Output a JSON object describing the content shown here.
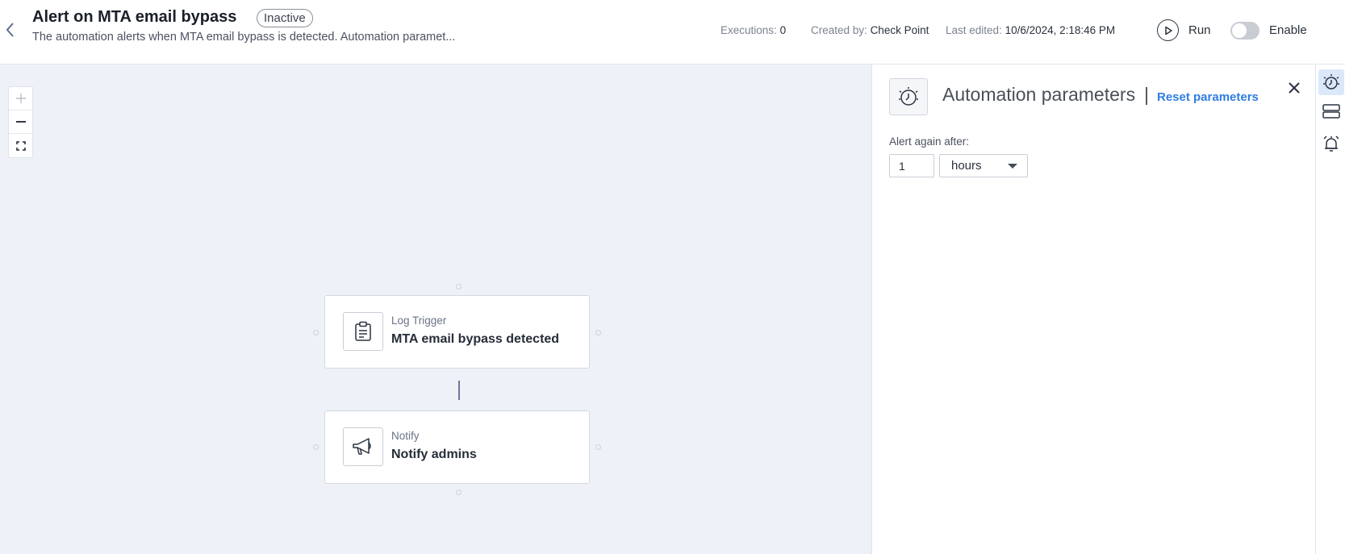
{
  "header": {
    "title": "Alert on MTA email bypass",
    "status": "Inactive",
    "description": "The automation alerts when MTA email bypass is detected. Automation paramet...",
    "executions_label": "Executions:",
    "executions_value": "0",
    "created_by_label": "Created by:",
    "created_by_value": "Check Point",
    "last_edited_label": "Last edited:",
    "last_edited_value": "10/6/2024, 2:18:46 PM",
    "run_label": "Run",
    "enable_label": "Enable",
    "enabled": false
  },
  "canvas": {
    "zoom_controls": [
      "zoom-in",
      "zoom-out",
      "fit-to-screen"
    ],
    "nodes": [
      {
        "type": "Log Trigger",
        "name": "MTA email bypass detected",
        "icon": "clipboard-icon"
      },
      {
        "type": "Notify",
        "name": "Notify admins",
        "icon": "megaphone-icon"
      }
    ]
  },
  "panel": {
    "title": "Automation parameters",
    "separator": "|",
    "reset_label": "Reset parameters",
    "field_label": "Alert again after:",
    "field_value": "1",
    "unit_value": "hours"
  },
  "rail": {
    "icons": [
      "alarm-gear-icon",
      "layers-icon",
      "alarm-bell-icon"
    ],
    "active": "alarm-gear-icon"
  },
  "colors": {
    "accent": "#2f7de1",
    "canvas_bg": "#eef1f8",
    "rail_active": "#dbe8fb"
  }
}
